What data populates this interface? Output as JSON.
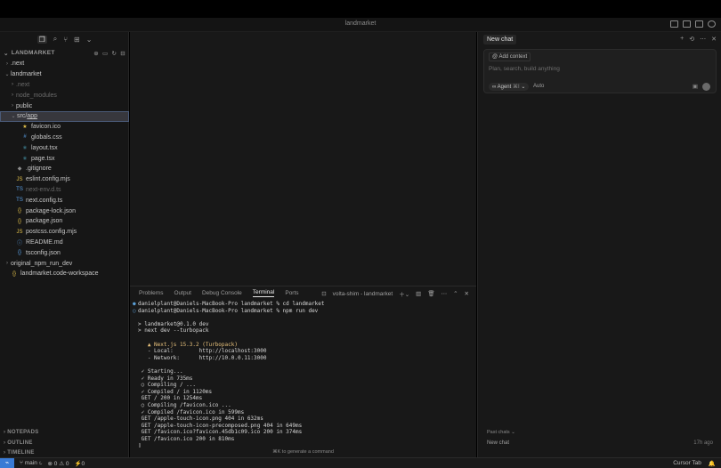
{
  "window": {
    "title": "landmarket"
  },
  "sidebar": {
    "toolbar_icons": [
      "files-icon",
      "search-icon",
      "source-control-icon",
      "extensions-icon",
      "chevron-down-icon"
    ],
    "workspace_label": "LANDMARKET",
    "tree": [
      {
        "label": ".next",
        "depth": 0,
        "chev": "›",
        "icon": "",
        "dim": false
      },
      {
        "label": "landmarket",
        "depth": 0,
        "chev": "⌄",
        "icon": "",
        "dim": false
      },
      {
        "label": ".next",
        "depth": 1,
        "chev": "›",
        "icon": "",
        "dim": true
      },
      {
        "label": "node_modules",
        "depth": 1,
        "chev": "›",
        "icon": "",
        "dim": true
      },
      {
        "label": "public",
        "depth": 1,
        "chev": "›",
        "icon": "",
        "dim": false
      },
      {
        "label": "src",
        "label2": "app",
        "depth": 1,
        "chev": "⌄",
        "icon": "",
        "dim": false,
        "selected": true
      },
      {
        "label": "favicon.ico",
        "depth": 2,
        "chev": "",
        "icon": "★",
        "iconColor": "#e2c04a",
        "dim": false
      },
      {
        "label": "globals.css",
        "depth": 2,
        "chev": "",
        "icon": "#",
        "iconColor": "#5aa0e6",
        "dim": false
      },
      {
        "label": "layout.tsx",
        "depth": 2,
        "chev": "",
        "icon": "⚛",
        "iconColor": "#5ac8e6",
        "dim": false
      },
      {
        "label": "page.tsx",
        "depth": 2,
        "chev": "",
        "icon": "⚛",
        "iconColor": "#5ac8e6",
        "dim": false
      },
      {
        "label": ".gitignore",
        "depth": 1,
        "chev": "",
        "icon": "◆",
        "iconColor": "#8a8a8a",
        "dim": false
      },
      {
        "label": "eslint.config.mjs",
        "depth": 1,
        "chev": "",
        "icon": "JS",
        "iconColor": "#e2c04a",
        "dim": false
      },
      {
        "label": "next-env.d.ts",
        "depth": 1,
        "chev": "",
        "icon": "TS",
        "iconColor": "#5aa0e6",
        "dim": true
      },
      {
        "label": "next.config.ts",
        "depth": 1,
        "chev": "",
        "icon": "TS",
        "iconColor": "#5aa0e6",
        "dim": false
      },
      {
        "label": "package-lock.json",
        "depth": 1,
        "chev": "",
        "icon": "{}",
        "iconColor": "#e2c04a",
        "dim": false
      },
      {
        "label": "package.json",
        "depth": 1,
        "chev": "",
        "icon": "{}",
        "iconColor": "#e2c04a",
        "dim": false
      },
      {
        "label": "postcss.config.mjs",
        "depth": 1,
        "chev": "",
        "icon": "JS",
        "iconColor": "#e2c04a",
        "dim": false
      },
      {
        "label": "README.md",
        "depth": 1,
        "chev": "",
        "icon": "ⓘ",
        "iconColor": "#5aa0e6",
        "dim": false
      },
      {
        "label": "tsconfig.json",
        "depth": 1,
        "chev": "",
        "icon": "{}",
        "iconColor": "#5aa0e6",
        "dim": false
      },
      {
        "label": "original_npm_run_dev",
        "depth": 0,
        "chev": "›",
        "icon": "",
        "dim": false
      },
      {
        "label": "landmarket.code-workspace",
        "depth": 0,
        "chev": "",
        "icon": "{}",
        "iconColor": "#e2c04a",
        "dim": false
      }
    ],
    "bottom_sections": [
      "NOTEPADS",
      "OUTLINE",
      "TIMELINE"
    ]
  },
  "panel": {
    "tabs": [
      "Problems",
      "Output",
      "Debug Console",
      "Terminal",
      "Ports"
    ],
    "active_tab": "Terminal",
    "terminal_name": "volta-shim - landmarket",
    "terminal_lines": [
      {
        "mark": "●",
        "text": "danielplant@Daniels-MacBook-Pro landmarket % cd landmarket"
      },
      {
        "mark": "○",
        "text": "danielplant@Daniels-MacBook-Pro landmarket % npm run dev"
      },
      {
        "mark": "",
        "text": ""
      },
      {
        "mark": "",
        "text": "> landmarket@0.1.0 dev"
      },
      {
        "mark": "",
        "text": "> next dev --turbopack"
      },
      {
        "mark": "",
        "text": ""
      },
      {
        "mark": "",
        "text": "   ▲ Next.js 15.3.2 (Turbopack)",
        "cls": "y"
      },
      {
        "mark": "",
        "text": "   - Local:        http://localhost:3000"
      },
      {
        "mark": "",
        "text": "   - Network:      http://10.0.0.11:3000"
      },
      {
        "mark": "",
        "text": ""
      },
      {
        "mark": "",
        "text": " ✓ Starting..."
      },
      {
        "mark": "",
        "text": " ✓ Ready in 735ms"
      },
      {
        "mark": "",
        "text": " ○ Compiling / ..."
      },
      {
        "mark": "",
        "text": " ✓ Compiled / in 1120ms"
      },
      {
        "mark": "",
        "text": " GET / 200 in 1254ms"
      },
      {
        "mark": "",
        "text": " ○ Compiling /favicon.ico ..."
      },
      {
        "mark": "",
        "text": " ✓ Compiled /favicon.ico in 599ms"
      },
      {
        "mark": "",
        "text": " GET /apple-touch-icon.png 404 in 632ms"
      },
      {
        "mark": "",
        "text": " GET /apple-touch-icon-precomposed.png 404 in 649ms"
      },
      {
        "mark": "",
        "text": " GET /favicon.ico?favicon.45db1c09.ico 200 in 374ms"
      },
      {
        "mark": "",
        "text": " GET /favicon.ico 200 in 810ms"
      },
      {
        "mark": "",
        "text": "▯"
      }
    ],
    "generate_hint": "⌘K to generate a command"
  },
  "chat": {
    "tab_label": "New chat",
    "add_context": "Add context",
    "placeholder": "Plan, search, build anything",
    "agent_label": "Agent",
    "agent_shortcut": "⌘I",
    "mode_label": "Auto",
    "past_chats_label": "Past chats",
    "past_chat_title": "New chat",
    "past_chat_time": "17h ago"
  },
  "statusbar": {
    "branch": "main",
    "errors": "⊗ 0 ⚠ 0",
    "ports": "⚡0",
    "right_label": "Cursor Tab"
  }
}
